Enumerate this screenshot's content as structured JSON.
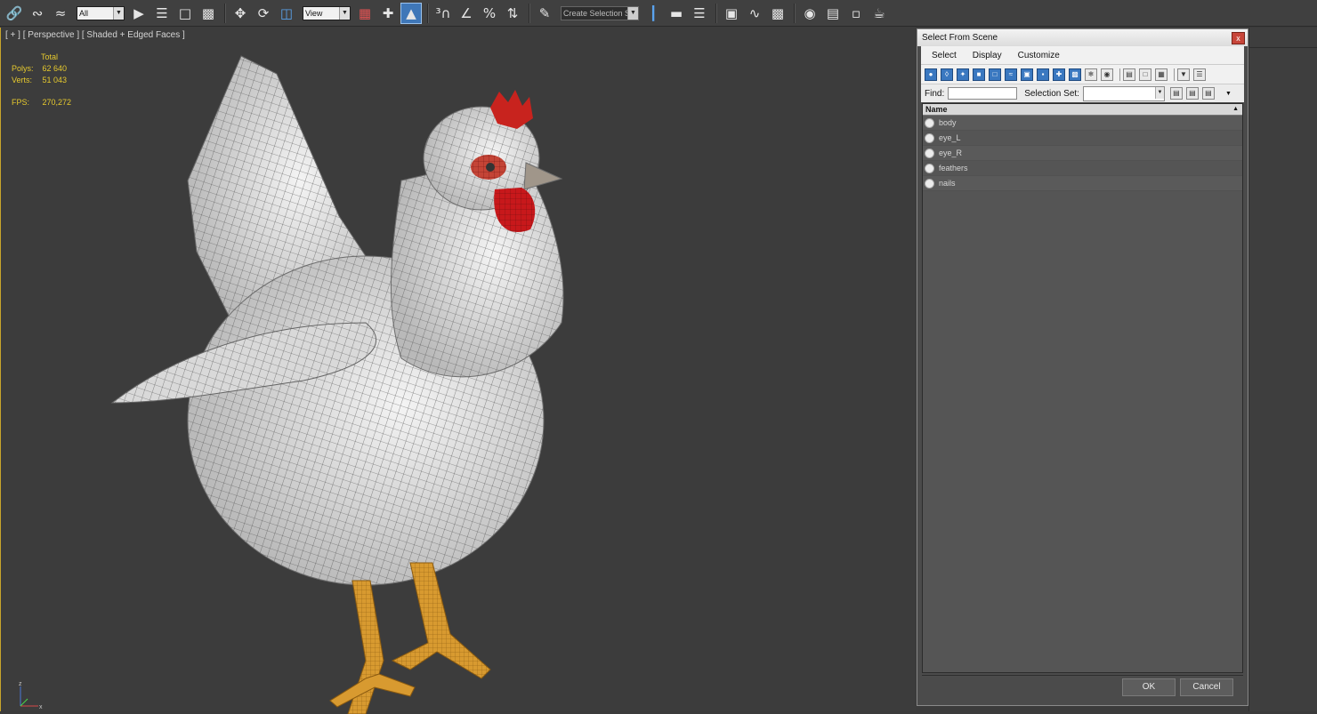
{
  "toolbar": {
    "filter_select": "All",
    "view_select": "View",
    "selection_set_select": "Create Selection Se",
    "icons": [
      "link-icon",
      "unlink-icon",
      "bind-space-warp-icon",
      "select-object-icon",
      "select-by-name-icon",
      "rectangular-region-icon",
      "window-crossing-icon",
      "move-icon",
      "rotate-icon",
      "scale-icon",
      "select-manipulate-icon",
      "keyboard-shortcut-icon",
      "snaps-toggle-icon",
      "angle-snap-icon",
      "percent-snap-icon",
      "spinner-snap-icon",
      "edit-named-selection-icon",
      "mirror-icon",
      "align-icon",
      "layer-manager-icon",
      "graphite-tools-icon",
      "curve-editor-icon",
      "schematic-view-icon",
      "material-editor-icon",
      "render-setup-icon",
      "rendered-frame-window-icon",
      "render-production-icon"
    ]
  },
  "viewport": {
    "label": "[ + ] [ Perspective ] [ Shaded + Edged Faces ]",
    "stats": {
      "total_label": "Total",
      "polys_label": "Polys:",
      "polys_value": "62 640",
      "verts_label": "Verts:",
      "verts_value": "51 043",
      "fps_label": "FPS:",
      "fps_value": "270,272"
    },
    "axis": {
      "z": "z",
      "x": "x"
    }
  },
  "dialog": {
    "title": "Select From Scene",
    "close": "x",
    "menu": [
      "Select",
      "Display",
      "Customize"
    ],
    "find_label": "Find:",
    "find_value": "",
    "selection_set_label": "Selection Set:",
    "list_header": "Name",
    "items": [
      "body",
      "eye_L",
      "eye_R",
      "feathers",
      "nails"
    ],
    "ok_label": "OK",
    "cancel_label": "Cancel"
  },
  "colors": {
    "accent_blue": "#3f77b8",
    "stats_yellow": "#e6c92e",
    "viewport_border": "#c8a52b",
    "viewport_bg": "#3c3c3c"
  }
}
